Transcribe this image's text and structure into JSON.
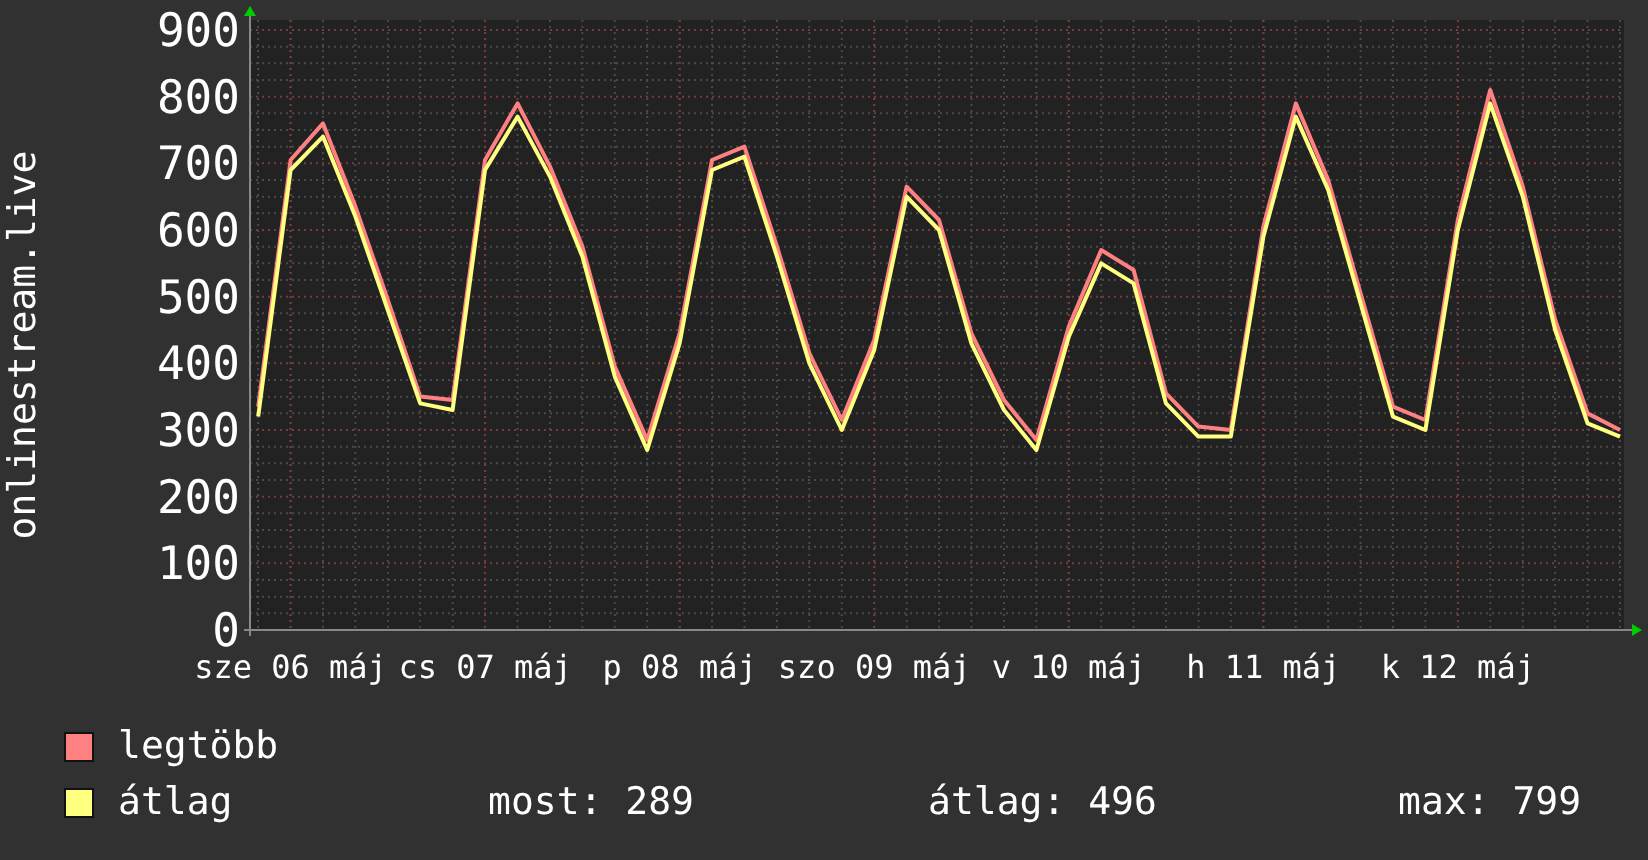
{
  "y_label": "onlinestream.live",
  "chart": {
    "chart_data": {
      "type": "line",
      "grid": true,
      "ylim": [
        0,
        900
      ],
      "categories": [
        null,
        "sze 06 máj",
        null,
        null,
        null,
        null,
        null,
        "cs 07 máj",
        null,
        null,
        null,
        null,
        null,
        "p 08 máj",
        null,
        null,
        null,
        null,
        null,
        "szo 09 máj",
        null,
        null,
        null,
        null,
        null,
        "v 10 máj",
        null,
        null,
        null,
        null,
        null,
        "h 11 máj",
        null,
        null,
        null,
        null,
        null,
        "k 12 máj",
        null,
        null,
        null,
        null,
        null
      ],
      "series": [
        {
          "name": "legtöbb",
          "color": "#ff8080",
          "values": [
            335,
            705,
            760,
            635,
            495,
            350,
            345,
            705,
            790,
            695,
            575,
            395,
            285,
            445,
            705,
            725,
            575,
            415,
            315,
            435,
            665,
            615,
            445,
            345,
            285,
            455,
            570,
            540,
            355,
            305,
            300,
            605,
            790,
            675,
            505,
            335,
            315,
            615,
            810,
            665,
            465,
            325,
            300
          ]
        },
        {
          "name": "átlag",
          "color": "#ffff80",
          "values": [
            320,
            690,
            740,
            620,
            480,
            340,
            330,
            690,
            770,
            680,
            560,
            380,
            270,
            430,
            690,
            710,
            560,
            400,
            300,
            420,
            650,
            600,
            430,
            330,
            270,
            440,
            550,
            520,
            340,
            290,
            290,
            590,
            770,
            660,
            490,
            320,
            300,
            600,
            790,
            650,
            450,
            310,
            290
          ]
        }
      ],
      "yticks": [
        0,
        100,
        200,
        300,
        400,
        500,
        600,
        700,
        800,
        900
      ]
    }
  },
  "legend_stats": [
    "most: 289",
    "átlag: 496",
    "max: 799"
  ]
}
